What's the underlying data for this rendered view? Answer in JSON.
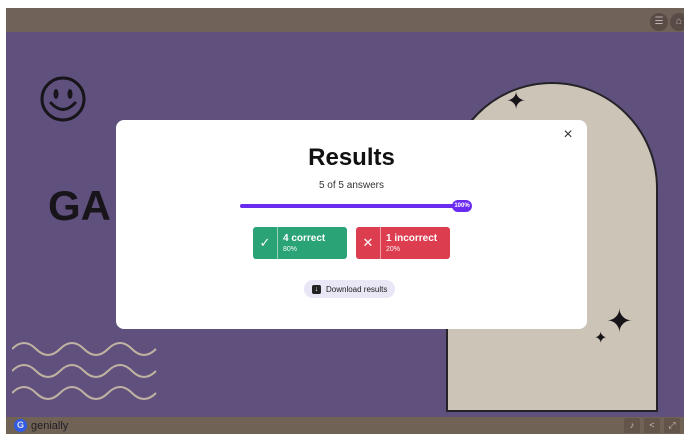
{
  "background": {
    "slide_text": "GA",
    "brand": "genially"
  },
  "modal": {
    "title": "Results",
    "subtitle": "5 of 5 answers",
    "progress": {
      "percent_label": "100%",
      "fraction": 1.0
    },
    "correct": {
      "label": "4 correct",
      "percent": "80%"
    },
    "incorrect": {
      "label": "1 incorrect",
      "percent": "20%"
    },
    "download_label": "Download results",
    "close_icon": "×"
  },
  "colors": {
    "accent": "#6a2bf0",
    "correct": "#2aa377",
    "incorrect": "#dc3d4f",
    "slide_bg": "#665687"
  },
  "icons": {
    "check": "✓",
    "cross": "✕"
  }
}
